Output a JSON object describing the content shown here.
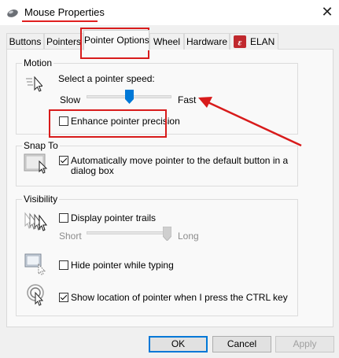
{
  "window": {
    "title": "Mouse Properties",
    "icon": "mouse-icon",
    "close_icon": "close-icon",
    "close_glyph": "✕"
  },
  "tabs": [
    {
      "label": "Buttons"
    },
    {
      "label": "Pointers"
    },
    {
      "label": "Pointer Options",
      "active": true
    },
    {
      "label": "Wheel"
    },
    {
      "label": "Hardware"
    },
    {
      "label": "ELAN",
      "icon": "elan-logo-icon"
    }
  ],
  "motion": {
    "legend": "Motion",
    "prompt": "Select a pointer speed:",
    "slow": "Slow",
    "fast": "Fast",
    "speed_level": 0.5,
    "enhance_label": "Enhance pointer precision",
    "enhance_checked": false
  },
  "snap_to": {
    "legend": "Snap To",
    "label_line1": "Automatically move pointer to the default button in a",
    "label_line2": "dialog box",
    "checked": true
  },
  "visibility": {
    "legend": "Visibility",
    "trails_label": "Display pointer trails",
    "trails_checked": false,
    "short": "Short",
    "long": "Long",
    "trails_level": 1.0,
    "hide_label": "Hide pointer while typing",
    "hide_checked": false,
    "show_location_label": "Show location of pointer when I press the CTRL key",
    "show_location_checked": true
  },
  "buttons": {
    "ok": "OK",
    "cancel": "Cancel",
    "apply": "Apply"
  },
  "annotation_color": "#d81b1b"
}
